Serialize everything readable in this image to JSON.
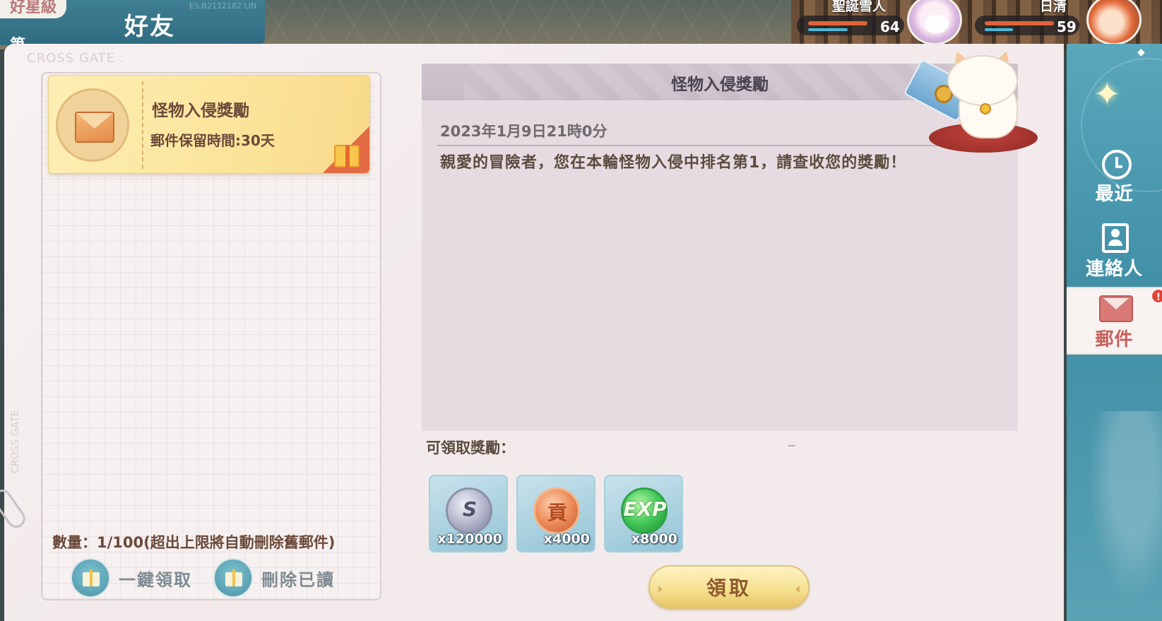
{
  "header": {
    "previous_tab_fragment": "好星級",
    "tab_title": "好友",
    "side_fragment": "第",
    "faint_code": "ES.B2112182 LIN"
  },
  "party": [
    {
      "name": "聖誕雪人",
      "level": "64",
      "hp_fraction": 0.8,
      "mp_fraction": 0.5
    },
    {
      "name": "日清",
      "level": "59",
      "hp_fraction": 0.9,
      "mp_fraction": 0.3
    }
  ],
  "brand": {
    "watermark": "CROSS GATE .",
    "vertical_watermark": "CROSS GATE"
  },
  "mail_list": {
    "items": [
      {
        "title": "怪物入侵獎勵",
        "retention": "郵件保留時間:30天"
      }
    ],
    "count_text": "數量：1/100(超出上限將自動刪除舊郵件)",
    "claim_all_label": "一鍵領取",
    "delete_read_label": "刪除已讀"
  },
  "detail": {
    "title": "怪物入侵獎勵",
    "date": "2023年1月9日21時0分",
    "body": "親愛的冒險者，您在本輪怪物入侵中排名第1，請查收您的獎勵！",
    "rewards_label": "可領取獎勵：",
    "rewards": [
      {
        "icon": "silver-coin-icon",
        "glyph": "S",
        "quantity": "x120000"
      },
      {
        "icon": "contribution-medal-icon",
        "glyph": "貢",
        "quantity": "x4000"
      },
      {
        "icon": "exp-orb-icon",
        "glyph": "EXP",
        "quantity": "x8000"
      }
    ],
    "claim_label": "領取"
  },
  "sidebar": {
    "items": [
      {
        "label": "最近",
        "icon": "clock-icon"
      },
      {
        "label": "連絡人",
        "icon": "contact-icon"
      },
      {
        "label": "郵件",
        "icon": "mail-icon"
      }
    ],
    "notification_badge": "!"
  },
  "colors": {
    "panel_bg": "#f3ebeb",
    "sidebar_teal": "#4a9ab0",
    "mail_item_gold": "#fbe49a",
    "claim_button": "#f5df8e"
  }
}
